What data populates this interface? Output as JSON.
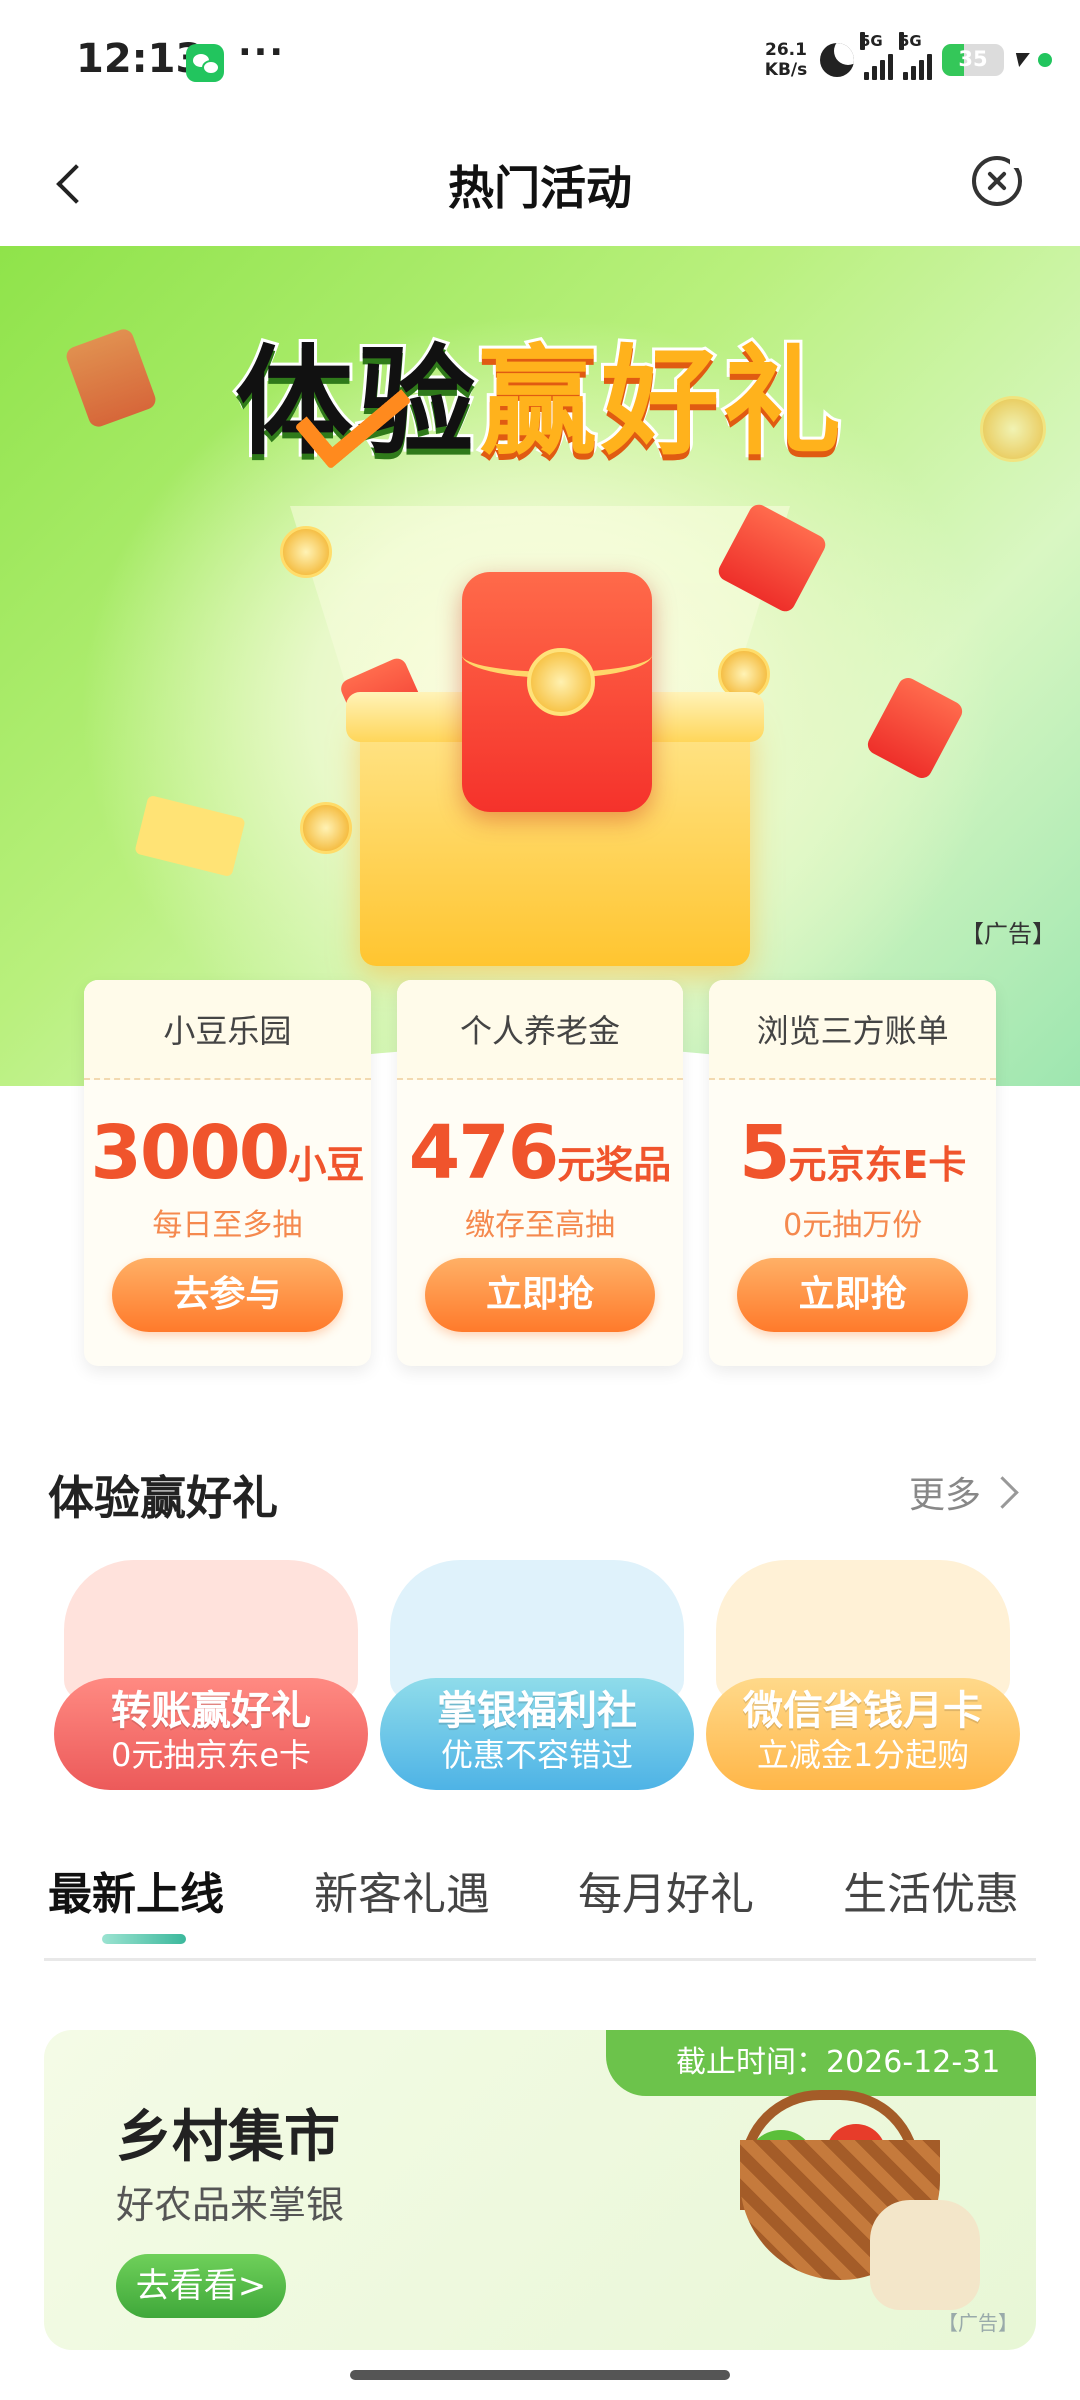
{
  "status_bar": {
    "time": "12:13",
    "net_speed": "26.1",
    "net_unit": "KB/s",
    "sig1": "5G",
    "sig2": "5G",
    "battery": "35"
  },
  "header": {
    "title": "热门活动"
  },
  "hero": {
    "title_part1": "体验",
    "title_part2": "赢好礼",
    "ad_label": "【广告】"
  },
  "promo_cards": [
    {
      "head": "小豆乐园",
      "amount": "3000",
      "unit": "小豆",
      "sub": "每日至多抽",
      "button": "去参与"
    },
    {
      "head": "个人养老金",
      "amount": "476",
      "unit": "元奖品",
      "sub": "缴存至高抽",
      "button": "立即抢"
    },
    {
      "head": "浏览三方账单",
      "amount": "5",
      "unit": "元京东E卡",
      "sub": "0元抽万份",
      "button": "立即抢"
    }
  ],
  "section": {
    "title": "体验赢好礼",
    "more": "更多"
  },
  "feature_cards": [
    {
      "title": "转账赢好礼",
      "sub": "0元抽京东e卡",
      "color": "#f06b6b"
    },
    {
      "title": "掌银福利社",
      "sub": "优惠不容错过",
      "color": "#66c4e6"
    },
    {
      "title": "微信省钱月卡",
      "sub": "立减金1分起购",
      "color": "#ffc862"
    }
  ],
  "tabs": [
    "最新上线",
    "新客礼遇",
    "每月好礼",
    "生活优惠"
  ],
  "activity": {
    "deadline": "截止时间：2026-12-31",
    "title": "乡村集市",
    "sub": "好农品来掌银",
    "button": "去看看>",
    "ad_label": "【广告】"
  }
}
